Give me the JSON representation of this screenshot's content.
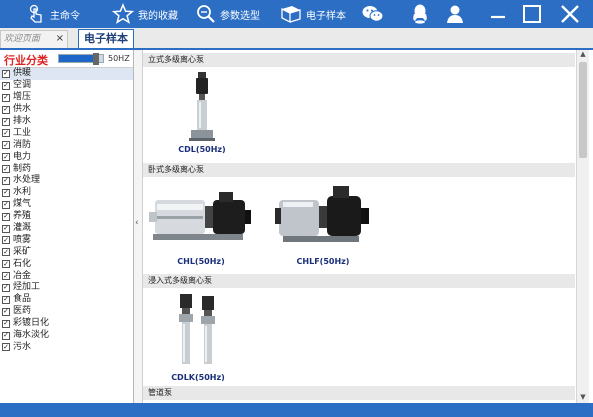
{
  "toolbar": {
    "main_command": "主命令",
    "favorites": "我的收藏",
    "param_select": "参数选型",
    "e_catalog": "电子样本"
  },
  "tabs": {
    "welcome": "欢迎页面",
    "close": "×",
    "catalog": "电子样本"
  },
  "left": {
    "title": "行业分类",
    "hz": "50HZ",
    "slider_fraction": 0.85,
    "items": [
      "供暖",
      "空调",
      "增压",
      "供水",
      "排水",
      "工业",
      "消防",
      "电力",
      "制药",
      "水处理",
      "水利",
      "煤气",
      "养殖",
      "灌溉",
      "喷雾",
      "采矿",
      "石化",
      "冶金",
      "烃加工",
      "食品",
      "医药",
      "彩镀日化",
      "海水淡化",
      "污水"
    ]
  },
  "collapse_arrow": "‹",
  "content": {
    "categories": [
      {
        "title": "立式多级离心泵",
        "products": [
          "CDL(50Hz)"
        ]
      },
      {
        "title": "卧式多级离心泵",
        "products": [
          "CHL(50Hz)",
          "CHLF(50Hz)"
        ]
      },
      {
        "title": "浸入式多级离心泵",
        "products": [
          "CDLK(50Hz)"
        ]
      },
      {
        "title": "管道泵",
        "products": []
      }
    ]
  },
  "scrollbar": {
    "up": "▲",
    "down": "▼"
  },
  "colors": {
    "accent": "#2b6ec4",
    "title_red": "#dd2222",
    "product_label": "#1a2f7a"
  }
}
